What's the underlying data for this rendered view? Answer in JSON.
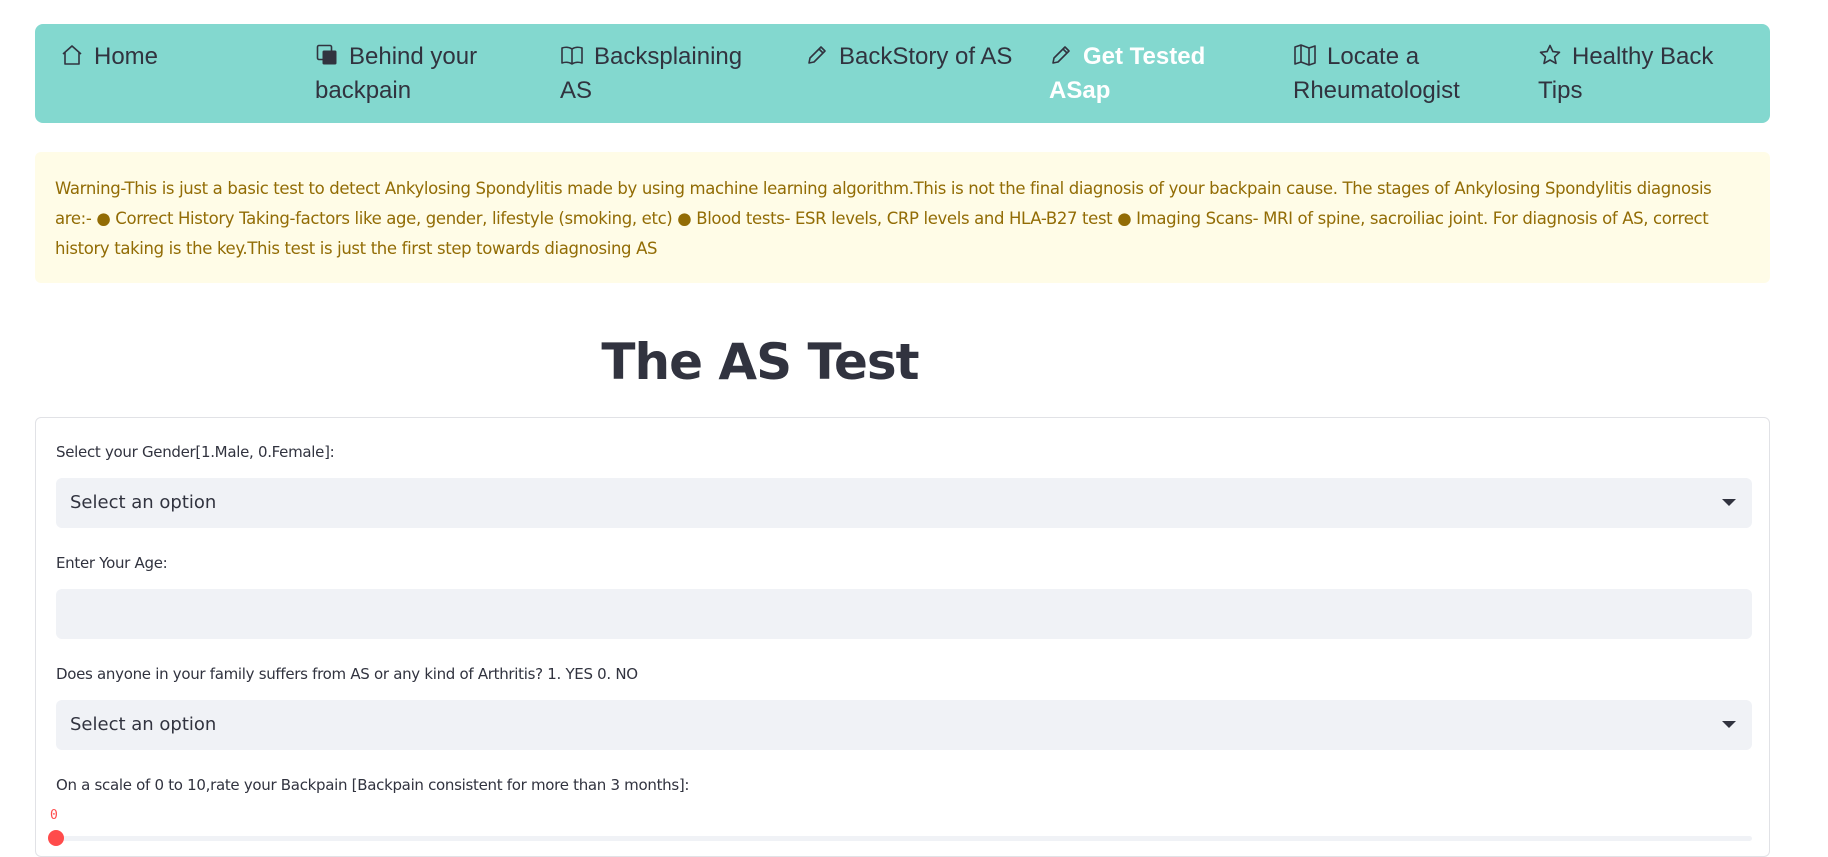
{
  "nav": {
    "items": [
      {
        "label": "Home",
        "icon": "house-icon"
      },
      {
        "label": "Behind your backpain",
        "icon": "squares-icon"
      },
      {
        "label": "Backsplaining AS",
        "icon": "book-icon"
      },
      {
        "label": "BackStory of AS",
        "icon": "pencil-icon"
      },
      {
        "label": "Get Tested ASap",
        "icon": "pencil-icon",
        "active": true
      },
      {
        "label": "Locate a Rheumatologist",
        "icon": "map-icon"
      },
      {
        "label": "Healthy Back Tips",
        "icon": "star-icon"
      }
    ],
    "colors": {
      "background": "#83d8cf",
      "active_text": "#ffffff",
      "text": "#31333f"
    }
  },
  "warning": {
    "text": "Warning-This is just a basic test to detect Ankylosing Spondylitis made by using machine learning algorithm.This is not the final diagnosis of your backpain cause. The stages of Ankylosing Spondylitis diagnosis are:- ● Correct History Taking-factors like age, gender, lifestyle (smoking, etc) ● Blood tests- ESR levels, CRP levels and HLA-B27 test ● Imaging Scans- MRI of spine, sacroiliac joint. For diagnosis of AS, correct history taking is the key.This test is just the first step towards diagnosing AS",
    "colors": {
      "background": "#fffce7",
      "text": "#926c05"
    }
  },
  "page": {
    "title": "The AS Test"
  },
  "form": {
    "gender": {
      "label": "Select your Gender[1.Male, 0.Female]:",
      "value": "Select an option"
    },
    "age": {
      "label": "Enter Your Age:",
      "value": ""
    },
    "family_history": {
      "label": "Does anyone in your family suffers from AS or any kind of Arthritis? 1. YES 0. NO",
      "value": "Select an option"
    },
    "backpain": {
      "label": "On a scale of 0 to 10,rate your Backpain [Backpain consistent for more than 3 months]:",
      "value": "0",
      "min": 0,
      "max": 10,
      "level": 0
    },
    "accent_color": "#ff4b4b"
  }
}
